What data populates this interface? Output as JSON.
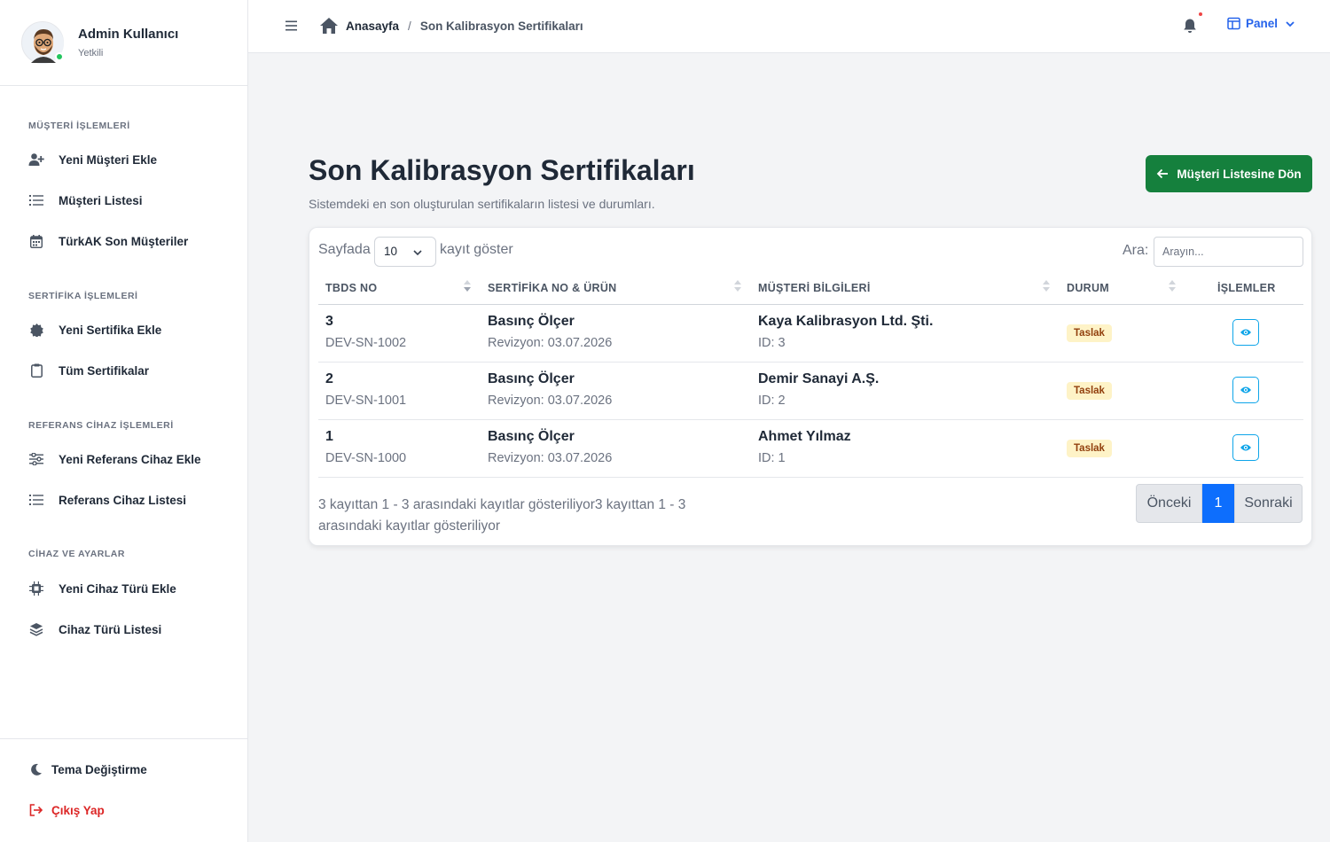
{
  "user": {
    "name": "Admin Kullanıcı",
    "role": "Yetkili"
  },
  "sidebar": {
    "sections": [
      {
        "title": "MÜŞTERİ İŞLEMLERİ",
        "items": [
          {
            "label": "Yeni Müşteri Ekle",
            "icon": "user-plus-icon"
          },
          {
            "label": "Müşteri Listesi",
            "icon": "list-icon"
          },
          {
            "label": "TürkAK Son Müşteriler",
            "icon": "calendar-icon"
          }
        ]
      },
      {
        "title": "SERTİFİKA İŞLEMLERİ",
        "items": [
          {
            "label": "Yeni Sertifika Ekle",
            "icon": "certificate-icon"
          },
          {
            "label": "Tüm Sertifikalar",
            "icon": "clipboard-icon"
          }
        ]
      },
      {
        "title": "REFERANS CİHAZ İŞLEMLERİ",
        "items": [
          {
            "label": "Yeni Referans Cihaz Ekle",
            "icon": "sliders-icon"
          },
          {
            "label": "Referans Cihaz Listesi",
            "icon": "list-icon"
          }
        ]
      },
      {
        "title": "CİHAZ VE AYARLAR",
        "items": [
          {
            "label": "Yeni Cihaz Türü Ekle",
            "icon": "chip-icon"
          },
          {
            "label": "Cihaz Türü Listesi",
            "icon": "layers-icon"
          }
        ]
      }
    ],
    "bottom": {
      "theme": "Tema Değiştirme",
      "logout": "Çıkış Yap"
    }
  },
  "topbar": {
    "breadcrumb_home": "Anasayfa",
    "breadcrumb_sep": "/",
    "breadcrumb_current": "Son Kalibrasyon Sertifikaları",
    "panel_label": "Panel"
  },
  "main": {
    "title": "Son Kalibrasyon Sertifikaları",
    "subtitle": "Sistemdeki en son oluşturulan sertifikaların listesi ve durumları.",
    "back_button": "Müşteri Listesine Dön"
  },
  "table": {
    "length_prefix": "Sayfada",
    "length_value": "10",
    "length_suffix": "kayıt göster",
    "search_label": "Ara:",
    "search_placeholder": "Arayın...",
    "columns": [
      "TBDS NO",
      "SERTİFİKA NO & ÜRÜN",
      "MÜŞTERİ BİLGİLERİ",
      "DURUM",
      "İŞLEMLER"
    ],
    "rows": [
      {
        "tbds": "3",
        "serial": "DEV-SN-1002",
        "product": "Basınç Ölçer",
        "revision": "Revizyon: 03.07.2026",
        "customer": "Kaya Kalibrasyon Ltd. Şti.",
        "customer_id": "ID: 3",
        "status": "Taslak"
      },
      {
        "tbds": "2",
        "serial": "DEV-SN-1001",
        "product": "Basınç Ölçer",
        "revision": "Revizyon: 03.07.2026",
        "customer": "Demir Sanayi A.Ş.",
        "customer_id": "ID: 2",
        "status": "Taslak"
      },
      {
        "tbds": "1",
        "serial": "DEV-SN-1000",
        "product": "Basınç Ölçer",
        "revision": "Revizyon: 03.07.2026",
        "customer": "Ahmet Yılmaz",
        "customer_id": "ID: 1",
        "status": "Taslak"
      }
    ],
    "info": "3 kayıttan 1 - 3 arasındaki kayıtlar gösteriliyor3 kayıttan 1 - 3 arasındaki kayıtlar gösteriliyor",
    "pagination": {
      "prev": "Önceki",
      "current": "1",
      "next": "Sonraki"
    }
  },
  "colors": {
    "accent": "#15803d",
    "primary": "#0d6efd",
    "info": "#0ea5e9",
    "badge_bg": "#fef3c7",
    "danger": "#dc2626"
  }
}
